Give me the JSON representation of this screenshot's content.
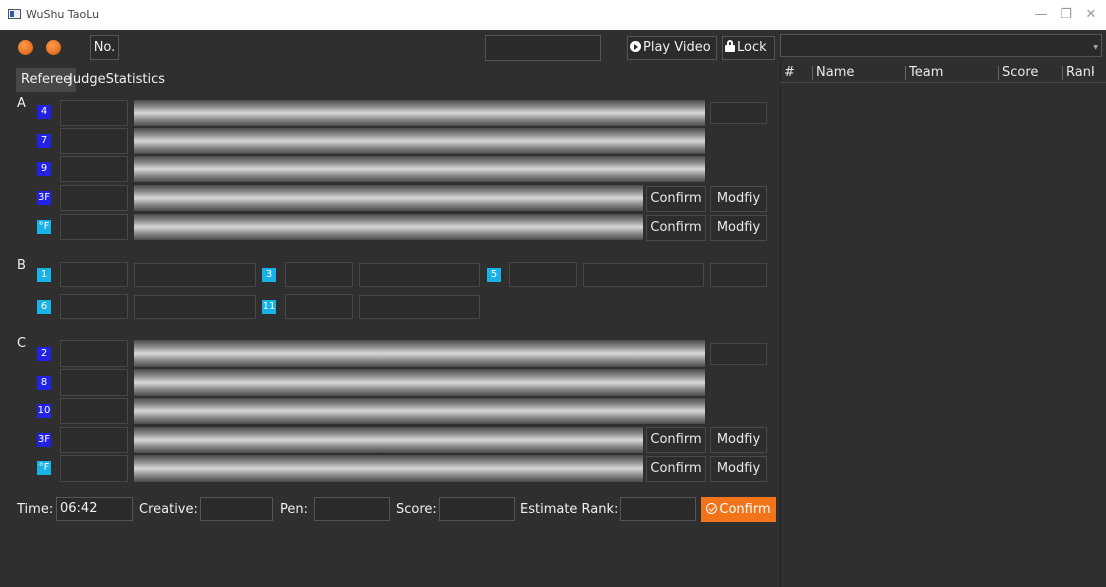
{
  "window": {
    "title": "WuShu TaoLu",
    "minimize": "—",
    "maximize": "❐",
    "close": "✕"
  },
  "toolbar": {
    "no_label": "No.",
    "play_label": "Play Video",
    "lock_label": "Lock",
    "dot_color": "#e8661a"
  },
  "tabs": [
    "Referee",
    "JudgeStatistics"
  ],
  "sections": {
    "a": {
      "label": "A",
      "rows": [
        {
          "badge": "4",
          "color": "blue"
        },
        {
          "badge": "7",
          "color": "blue"
        },
        {
          "badge": "9",
          "color": "blue"
        },
        {
          "badge": "3F",
          "color": "blue",
          "confirm": "Confirm",
          "modify": "Modfiy"
        },
        {
          "badge": "°F",
          "color": "cyan",
          "confirm": "Confirm",
          "modify": "Modfiy"
        }
      ]
    },
    "b": {
      "label": "B",
      "badges": [
        "1",
        "3",
        "5",
        "6",
        "11"
      ]
    },
    "c": {
      "label": "C",
      "rows": [
        {
          "badge": "2",
          "color": "blue"
        },
        {
          "badge": "8",
          "color": "blue"
        },
        {
          "badge": "10",
          "color": "blue"
        },
        {
          "badge": "3F",
          "color": "blue",
          "confirm": "Confirm",
          "modify": "Modfiy"
        },
        {
          "badge": "°F",
          "color": "cyan",
          "confirm": "Confirm",
          "modify": "Modfiy"
        }
      ]
    }
  },
  "bottom": {
    "time_label": "Time:",
    "time_value": "06:42",
    "creative_label": "Creative:",
    "pen_label": "Pen:",
    "score_label": "Score:",
    "estimate_label": "Estimate Rank:",
    "confirm_label": "Confirm"
  },
  "right_panel": {
    "columns": [
      "#",
      "Name",
      "Team",
      "Score",
      "Rank"
    ]
  },
  "colors": {
    "background": "#2f2f2f",
    "badge_blue": "#2222e6",
    "badge_cyan": "#17b3e8",
    "accent_orange": "#f27318"
  }
}
